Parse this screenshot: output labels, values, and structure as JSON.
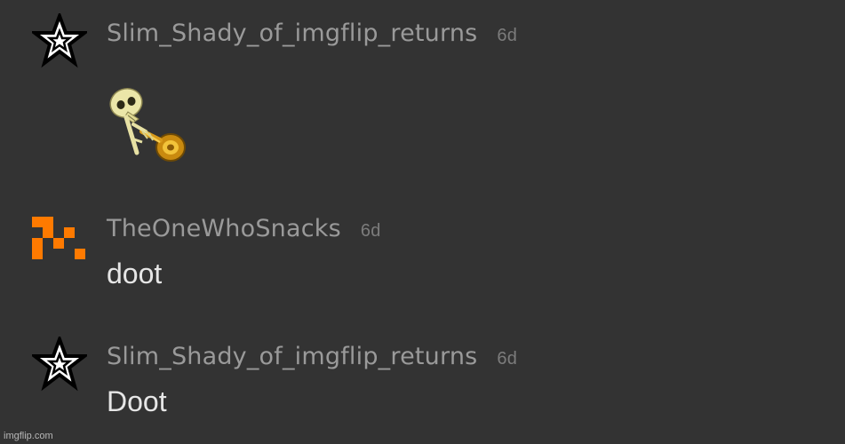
{
  "comments": [
    {
      "username": "Slim_Shady_of_imgflip_returns",
      "time": "6d",
      "avatar_icon": "star-icon",
      "attachment_icon": "doot-skeleton-trumpet-icon"
    },
    {
      "username": "TheOneWhoSnacks",
      "time": "6d",
      "avatar_icon": "orange-pixel-arrow-icon",
      "text": "doot"
    },
    {
      "username": "Slim_Shady_of_imgflip_returns",
      "time": "6d",
      "avatar_icon": "star-icon",
      "text": "Doot"
    }
  ],
  "watermark": "imgflip.com",
  "colors": {
    "background": "#333333",
    "username": "#9a9a9a",
    "timestamp": "#7c7c7c",
    "text": "#e6e6e6",
    "accent_orange": "#ff7a00"
  }
}
